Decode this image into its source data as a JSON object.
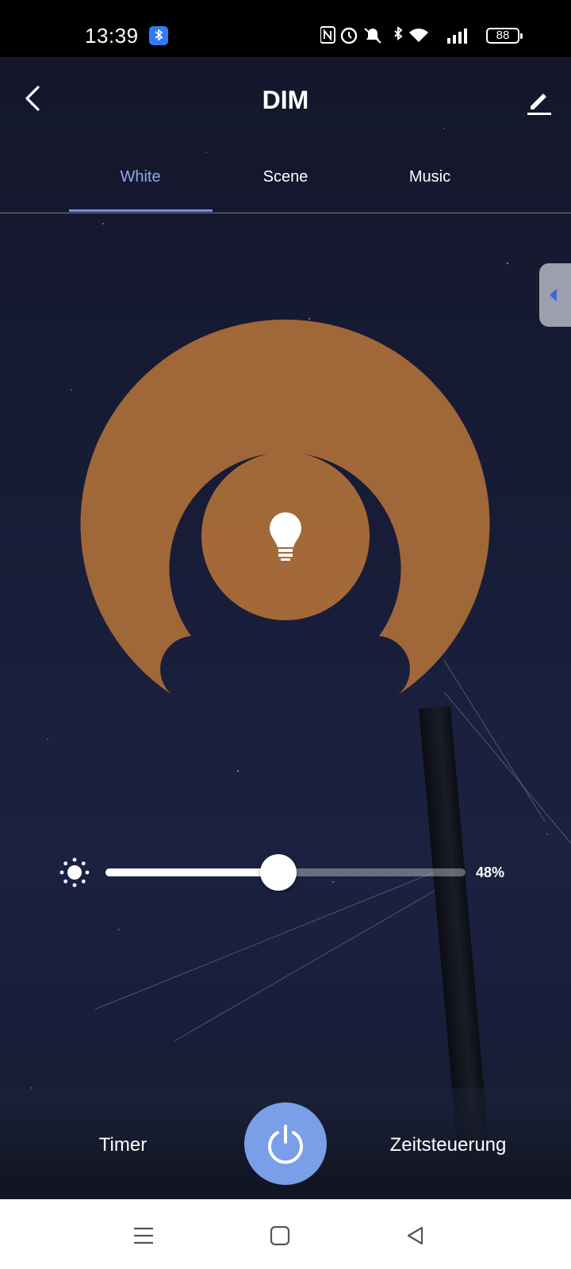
{
  "status_bar": {
    "time": "13:39",
    "battery": "88",
    "icons": [
      "bluetooth-badge-icon",
      "nfc-icon",
      "alarm-icon",
      "bell-off-icon",
      "bluetooth-icon",
      "wifi-icon",
      "signal-icon",
      "battery-icon"
    ]
  },
  "header": {
    "title": "DIM",
    "back_icon": "chevron-left-icon",
    "edit_icon": "pencil-icon"
  },
  "tabs": [
    {
      "label": "White",
      "active": true
    },
    {
      "label": "Scene",
      "active": false
    },
    {
      "label": "Music",
      "active": false
    }
  ],
  "dial": {
    "color": "#a96c38",
    "center_icon": "lightbulb-icon"
  },
  "brightness": {
    "icon": "sun-icon",
    "value": 48,
    "label": "48%"
  },
  "bottom_bar": {
    "timer_label": "Timer",
    "schedule_label": "Zeitsteuerung",
    "power_icon": "power-icon",
    "power_color": "#7a9ee8"
  },
  "nav": {
    "items": [
      "menu-icon",
      "home-square-icon",
      "back-triangle-icon"
    ]
  },
  "colors": {
    "accent": "#6f90e6",
    "tab_active": "#8fa9ef"
  }
}
